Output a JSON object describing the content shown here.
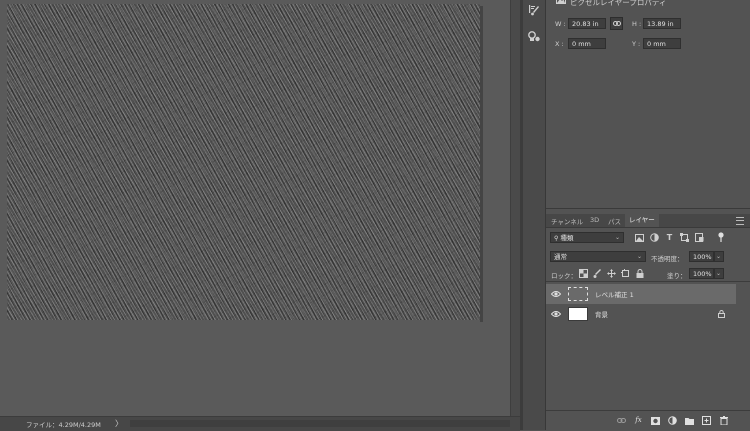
{
  "status_bar": {
    "file_info": "ファイル：4.29M/4.29M",
    "arrow": "〉"
  },
  "properties": {
    "title": "ピクセルレイヤープロパティ",
    "w_label": "W :",
    "w_value": "20.83 in",
    "h_label": "H :",
    "h_value": "13.89 in",
    "x_label": "X :",
    "x_value": "0 mm",
    "y_label": "Y :",
    "y_value": "0 mm"
  },
  "layers_panel": {
    "tabs": [
      "チャンネル",
      "3D",
      "パス",
      "レイヤー"
    ],
    "active_tab": "レイヤー",
    "filter_label": "種類",
    "blend_mode": "通常",
    "opacity_label": "不透明度：",
    "opacity_value": "100%",
    "lock_label": "ロック：",
    "fill_label": "塗り：",
    "fill_value": "100%",
    "layers": [
      {
        "name": "レベル補正 1",
        "visible": true,
        "selected": true,
        "thumbnail": "white-outline"
      },
      {
        "name": "背景",
        "visible": true,
        "selected": false,
        "thumbnail": "white",
        "locked": true
      }
    ]
  },
  "colors": {
    "workspace": "#5a5a5a",
    "panel": "#535353",
    "selected_row": "#6a6a6a",
    "text": "#d6d6d6"
  }
}
